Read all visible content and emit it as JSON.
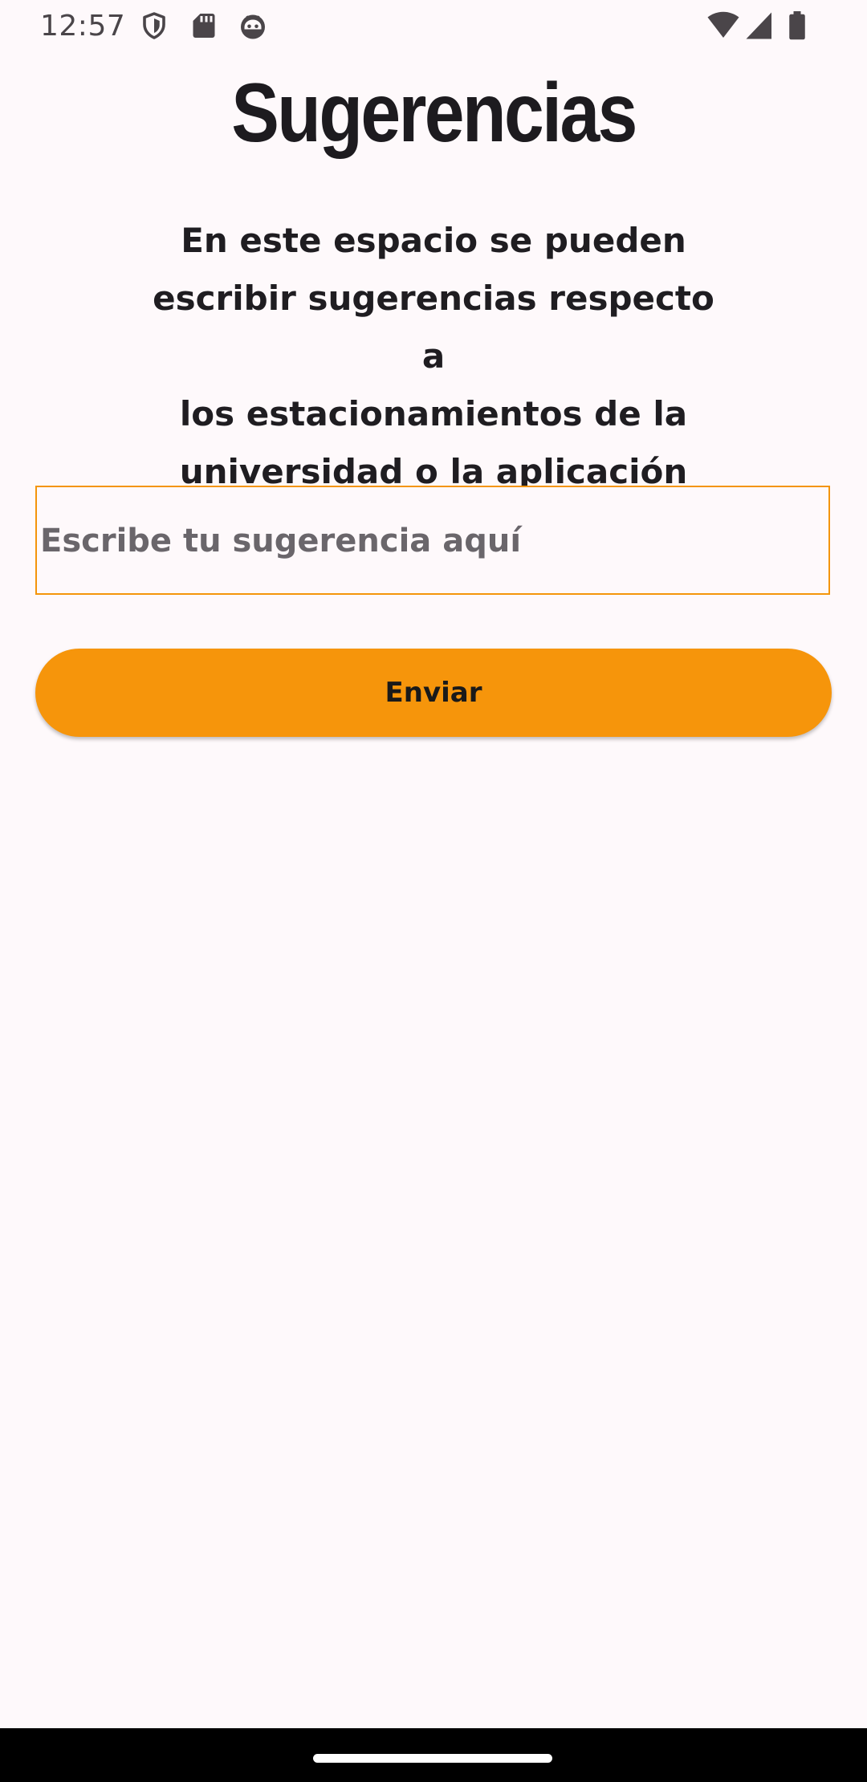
{
  "status_bar": {
    "time": "12:57",
    "left_icons": [
      "shield-icon",
      "sd-card-icon",
      "android-face-icon"
    ],
    "right_icons": [
      "wifi-icon",
      "cell-signal-icon",
      "battery-icon"
    ]
  },
  "page": {
    "title": "Sugerencias",
    "description_lines": [
      "En este espacio se pueden",
      "escribir sugerencias respecto a",
      "los estacionamientos de la",
      "universidad o la aplicación"
    ]
  },
  "suggestion_input": {
    "value": "",
    "placeholder": "Escribe tu sugerencia aquí"
  },
  "send_button": {
    "label": "Enviar"
  },
  "colors": {
    "accent": "#f6950b",
    "background": "#fef9fb",
    "text": "#1d1b1f"
  }
}
